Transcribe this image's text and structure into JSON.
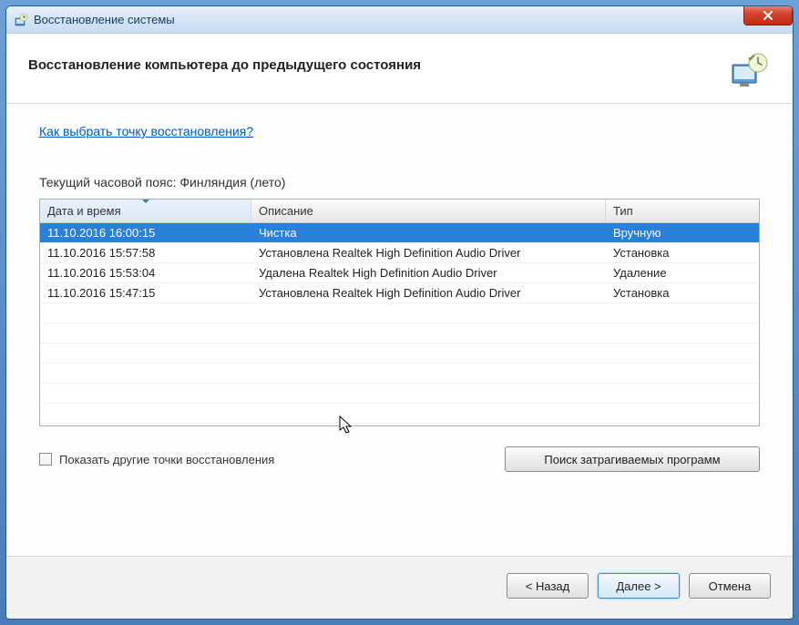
{
  "window": {
    "title": "Восстановление системы"
  },
  "header": {
    "title": "Восстановление компьютера до предыдущего состояния"
  },
  "content": {
    "help_link": "Как выбрать точку восстановления?",
    "timezone_label": "Текущий часовой пояс: Финляндия (лето)"
  },
  "table": {
    "columns": {
      "date": "Дата и время",
      "description": "Описание",
      "type": "Тип"
    },
    "rows": [
      {
        "date": "11.10.2016 16:00:15",
        "description": "Чистка",
        "type": "Вручную",
        "selected": true
      },
      {
        "date": "11.10.2016 15:57:58",
        "description": "Установлена Realtek High Definition Audio Driver",
        "type": "Установка",
        "selected": false
      },
      {
        "date": "11.10.2016 15:53:04",
        "description": "Удалена Realtek High Definition Audio Driver",
        "type": "Удаление",
        "selected": false
      },
      {
        "date": "11.10.2016 15:47:15",
        "description": "Установлена Realtek High Definition Audio Driver",
        "type": "Установка",
        "selected": false
      }
    ]
  },
  "controls": {
    "show_more_checkbox_label": "Показать другие точки восстановления",
    "scan_button": "Поиск затрагиваемых программ"
  },
  "footer": {
    "back": "< Назад",
    "next": "Далее >",
    "cancel": "Отмена"
  }
}
